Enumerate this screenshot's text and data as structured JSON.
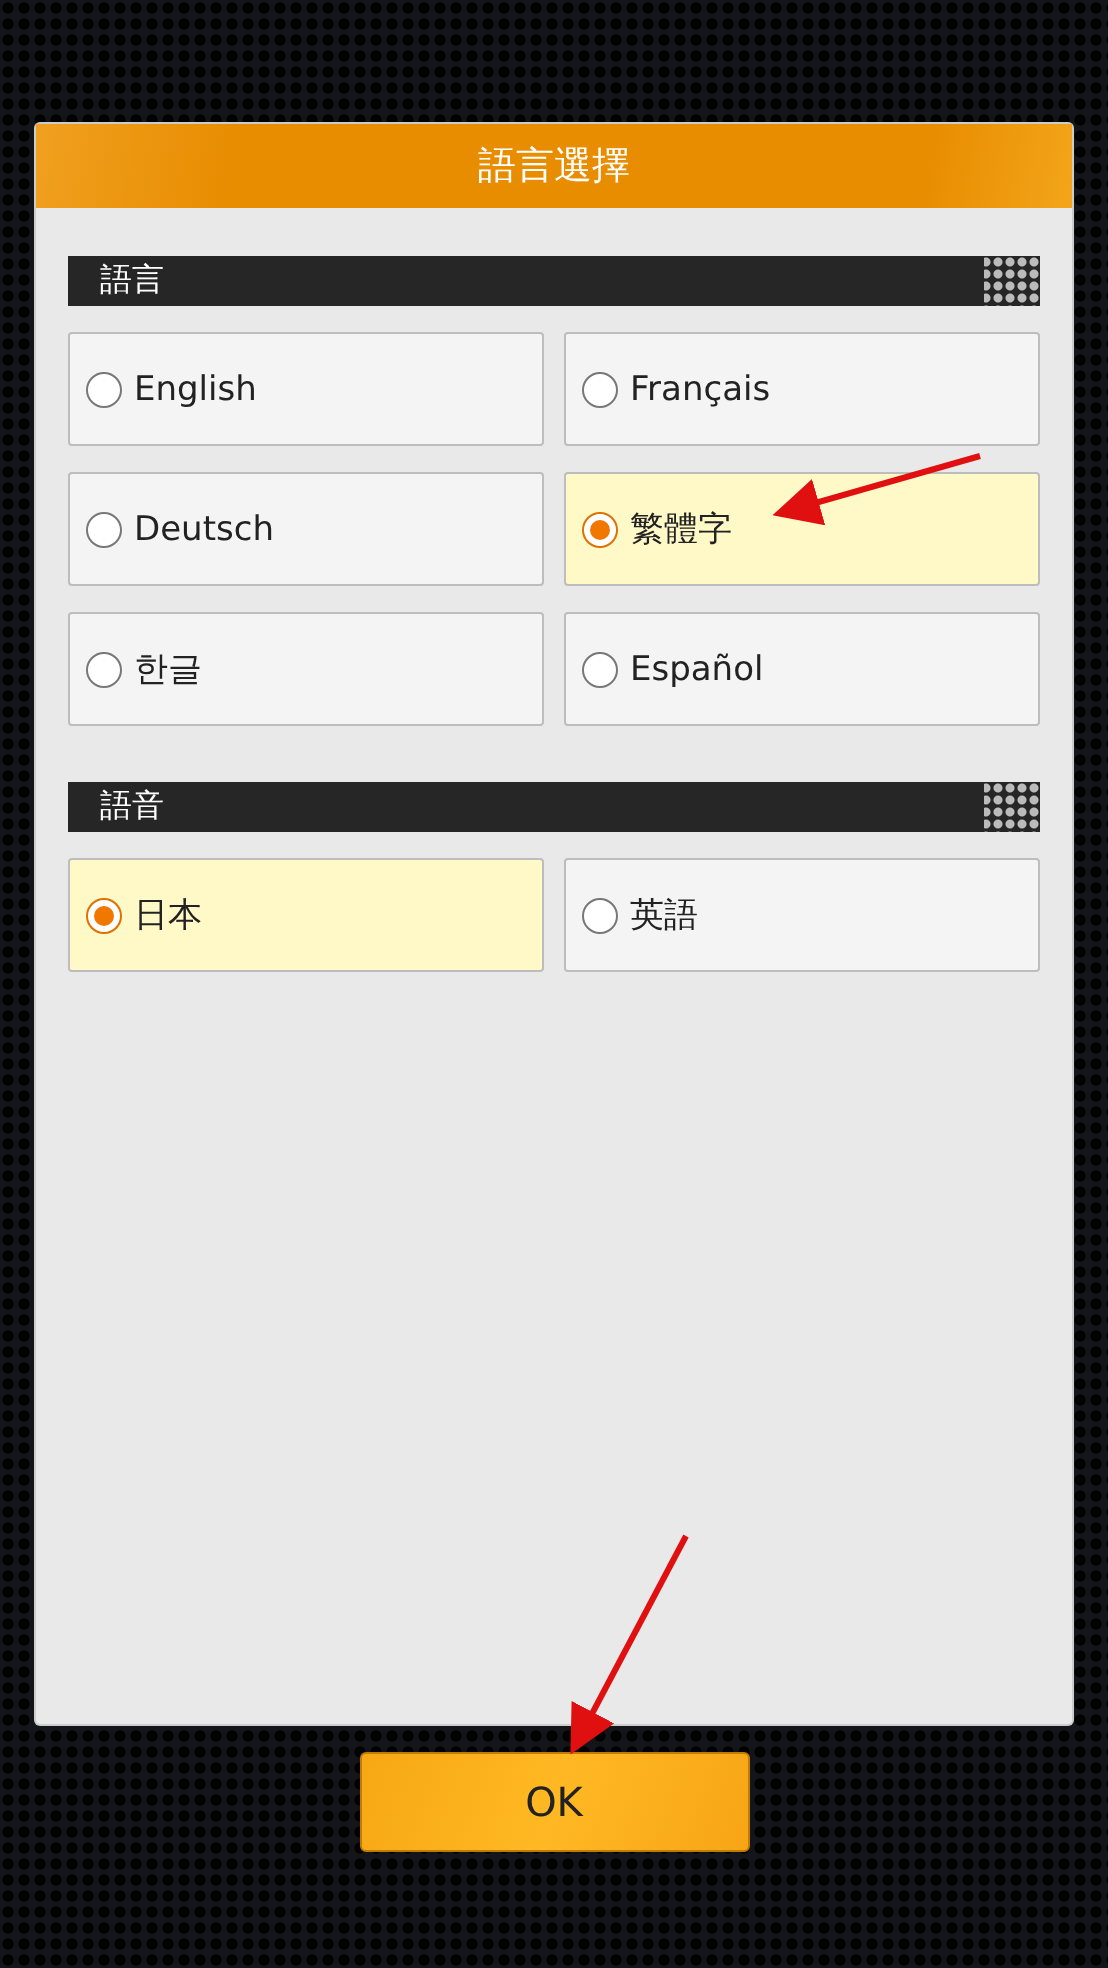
{
  "dialog": {
    "title": "語言選擇"
  },
  "sections": [
    {
      "title": "語言",
      "options": [
        {
          "label": "English",
          "selected": false
        },
        {
          "label": "Français",
          "selected": false
        },
        {
          "label": "Deutsch",
          "selected": false
        },
        {
          "label": "繁體字",
          "selected": true
        },
        {
          "label": "한글",
          "selected": false
        },
        {
          "label": "Español",
          "selected": false
        }
      ]
    },
    {
      "title": "語音",
      "options": [
        {
          "label": "日本",
          "selected": true
        },
        {
          "label": "英語",
          "selected": false
        }
      ]
    }
  ],
  "buttons": [
    {
      "label": "OK"
    }
  ]
}
